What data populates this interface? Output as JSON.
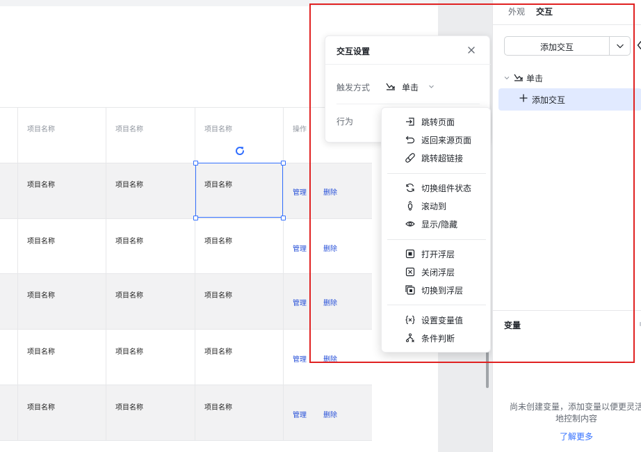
{
  "table": {
    "header": [
      "项目名称",
      "项目名称",
      "项目名称",
      "操作"
    ],
    "rows": [
      [
        "项目名称",
        "项目名称",
        "项目名称"
      ],
      [
        "项目名称",
        "项目名称",
        "项目名称"
      ],
      [
        "项目名称",
        "项目名称",
        "项目名称"
      ],
      [
        "项目名称",
        "项目名称",
        "项目名称"
      ],
      [
        "项目名称",
        "项目名称",
        "项目名称"
      ]
    ],
    "actions": {
      "manage": "管理",
      "delete": "删除"
    }
  },
  "interaction_panel": {
    "title": "交互设置",
    "trigger_label": "触发方式",
    "trigger_value": "单击",
    "behavior_label": "行为"
  },
  "behavior_menu": {
    "groups": [
      [
        {
          "icon": "jump-page-icon",
          "label": "跳转页面"
        },
        {
          "icon": "return-icon",
          "label": "返回来源页面"
        },
        {
          "icon": "link-icon",
          "label": "跳转超链接"
        }
      ],
      [
        {
          "icon": "switch-state-icon",
          "label": "切换组件状态"
        },
        {
          "icon": "scroll-icon",
          "label": "滚动到"
        },
        {
          "icon": "eye-icon",
          "label": "显示/隐藏"
        }
      ],
      [
        {
          "icon": "open-layer-icon",
          "label": "打开浮层"
        },
        {
          "icon": "close-layer-icon",
          "label": "关闭浮层"
        },
        {
          "icon": "switch-layer-icon",
          "label": "切换到浮层"
        }
      ],
      [
        {
          "icon": "variable-icon",
          "label": "设置变量值"
        },
        {
          "icon": "condition-icon",
          "label": "条件判断"
        }
      ]
    ]
  },
  "sidebar": {
    "tabs": [
      {
        "label": "外观",
        "active": false
      },
      {
        "label": "交互",
        "active": true
      }
    ],
    "add_button": "添加交互",
    "event": {
      "label": "单击"
    },
    "add_row": "添加交互",
    "variables": {
      "title": "变量",
      "empty_text": "尚未创建变量，添加变量以便更灵活地控制内容",
      "learn_more": "了解更多"
    }
  },
  "colors": {
    "accent": "#3370ff",
    "action_link": "#2750d8",
    "highlight_box": "#e02020",
    "selected_row": "#e1eaff"
  }
}
